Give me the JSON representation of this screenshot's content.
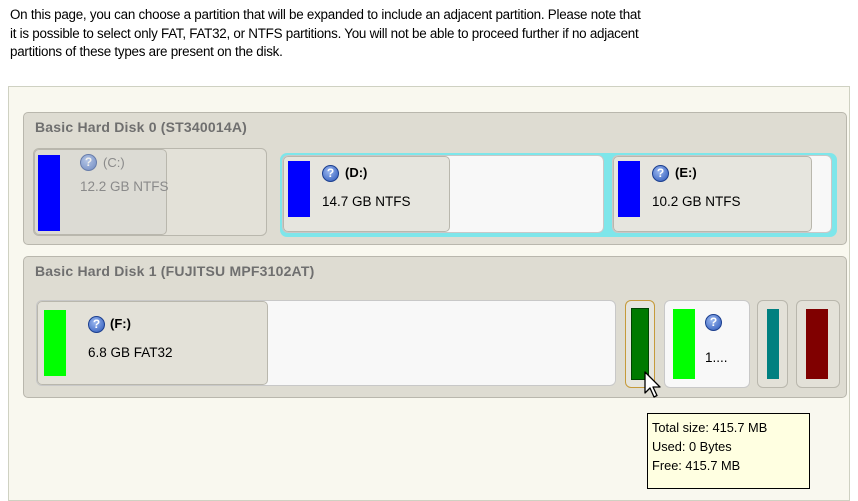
{
  "intro": {
    "line1": "On this page, you can choose a partition that will be expanded to include an adjacent partition. Please note that",
    "line2": "it is possible to select only FAT, FAT32, or NTFS partitions. You will not be able to proceed further if no adjacent",
    "line3": "partitions of these types are present on the disk."
  },
  "disks": [
    {
      "title": "Basic Hard Disk 0 (ST340014A)",
      "partitions": [
        {
          "label": "(C:)",
          "size": "12.2 GB NTFS",
          "color": "#0000ff",
          "state": "disabled"
        },
        {
          "label": "(D:)",
          "size": "14.7 GB NTFS",
          "color": "#0000ff",
          "state": "selected"
        },
        {
          "label": "(E:)",
          "size": "10.2 GB NTFS",
          "color": "#0000ff",
          "state": "selected"
        }
      ]
    },
    {
      "title": "Basic Hard Disk 1 (FUJITSU MPF3102AT)",
      "partitions": [
        {
          "label": "(F:)",
          "size": "6.8 GB FAT32",
          "color": "#00ff00"
        },
        {
          "label": "",
          "size": "",
          "color": "#007a00",
          "state": "hovered"
        },
        {
          "label": "",
          "size": "1....",
          "color": "#00ff00"
        },
        {
          "label": "",
          "size": "",
          "color": "#008080"
        },
        {
          "label": "",
          "size": "",
          "color": "#800000"
        }
      ]
    }
  ],
  "tooltip": {
    "total": "Total size: 415.7 MB",
    "used": "Used: 0 Bytes",
    "free": "Free: 415.7 MB"
  },
  "icons": {
    "partition_info": "question-icon",
    "cursor": "mouse-pointer-icon"
  }
}
